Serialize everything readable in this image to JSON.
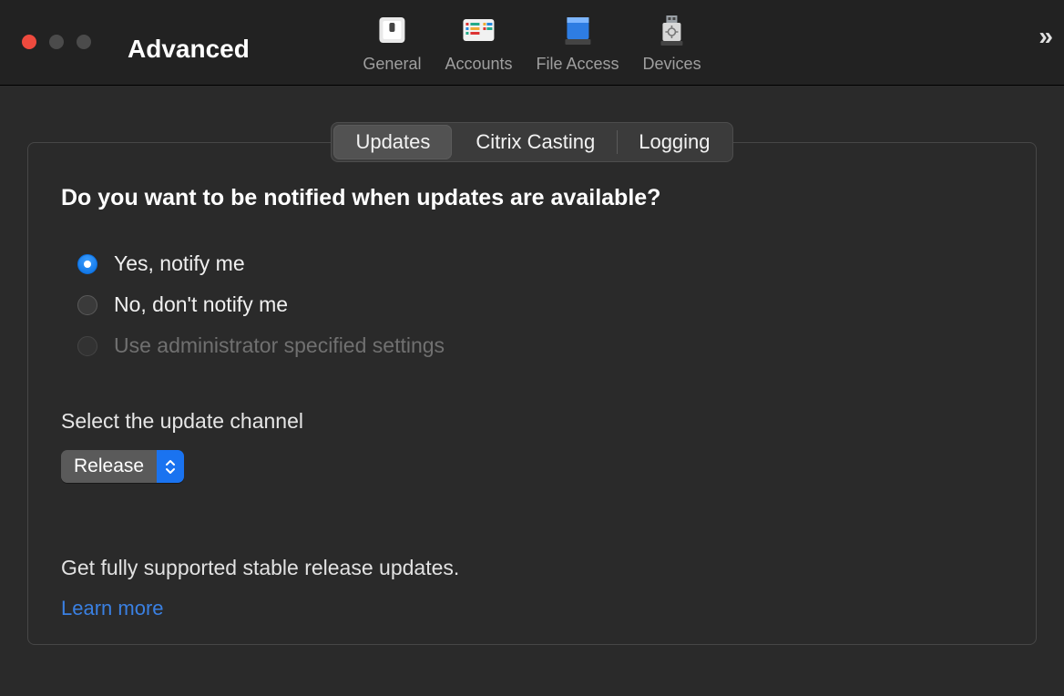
{
  "window": {
    "title": "Advanced"
  },
  "toolbar": {
    "items": [
      {
        "label": "General"
      },
      {
        "label": "Accounts"
      },
      {
        "label": "File Access"
      },
      {
        "label": "Devices"
      }
    ]
  },
  "tabs": {
    "items": [
      {
        "label": "Updates",
        "active": true
      },
      {
        "label": "Citrix Casting",
        "active": false
      },
      {
        "label": "Logging",
        "active": false
      }
    ]
  },
  "updates": {
    "question": "Do you want to be notified when updates are available?",
    "options": [
      {
        "label": "Yes, notify me",
        "checked": true,
        "disabled": false
      },
      {
        "label": "No, don't notify me",
        "checked": false,
        "disabled": false
      },
      {
        "label": "Use administrator specified settings",
        "checked": false,
        "disabled": true
      }
    ],
    "channel_label": "Select the update channel",
    "channel_selected": "Release",
    "channel_desc": "Get fully supported stable release updates.",
    "learn_more": "Learn more"
  }
}
